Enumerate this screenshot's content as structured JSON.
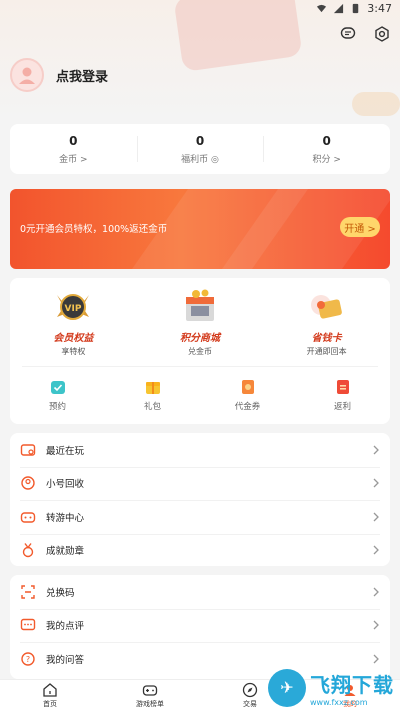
{
  "status_bar": {
    "time": "3:47"
  },
  "profile": {
    "login_label": "点我登录"
  },
  "stats": [
    {
      "value": "0",
      "label": "金币 >"
    },
    {
      "value": "0",
      "label": "福利币 ◎"
    },
    {
      "value": "0",
      "label": "积分 >"
    }
  ],
  "vip_banner": {
    "text": "0元开通会员特权，100%返还金币",
    "button": "开通 >"
  },
  "perks": [
    {
      "title": "会员权益",
      "subtitle": "享特权",
      "icon": "vip-badge-icon"
    },
    {
      "title": "积分商城",
      "subtitle": "兑金币",
      "icon": "points-store-icon"
    },
    {
      "title": "省钱卡",
      "subtitle": "开通即回本",
      "icon": "saving-card-icon"
    }
  ],
  "shortcuts": [
    {
      "label": "预约",
      "icon": "reserve-icon"
    },
    {
      "label": "礼包",
      "icon": "gift-icon"
    },
    {
      "label": "代金券",
      "icon": "voucher-icon"
    },
    {
      "label": "返利",
      "icon": "rebate-icon"
    }
  ],
  "menu1": [
    {
      "label": "最近在玩",
      "icon": "recent-play-icon"
    },
    {
      "label": "小号回收",
      "icon": "account-recycle-icon"
    },
    {
      "label": "转游中心",
      "icon": "transfer-game-icon"
    },
    {
      "label": "成就勋章",
      "icon": "medal-icon"
    }
  ],
  "menu2": [
    {
      "label": "兑换码",
      "icon": "redeem-code-icon"
    },
    {
      "label": "我的点评",
      "icon": "review-icon"
    },
    {
      "label": "我的问答",
      "icon": "qa-icon"
    }
  ],
  "tabbar": [
    {
      "label": "首页",
      "icon": "home-icon"
    },
    {
      "label": "游戏榜单",
      "icon": "gamepad-icon"
    },
    {
      "label": "交易",
      "icon": "compass-icon"
    },
    {
      "label": "我的",
      "icon": "profile-icon"
    }
  ],
  "watermark": {
    "title": "飞翔下载",
    "url": "www.fxxz.com"
  },
  "colors": {
    "accent": "#f25a2c",
    "vip_banner": "#f5522e",
    "vip_button": "#ffd66b"
  }
}
